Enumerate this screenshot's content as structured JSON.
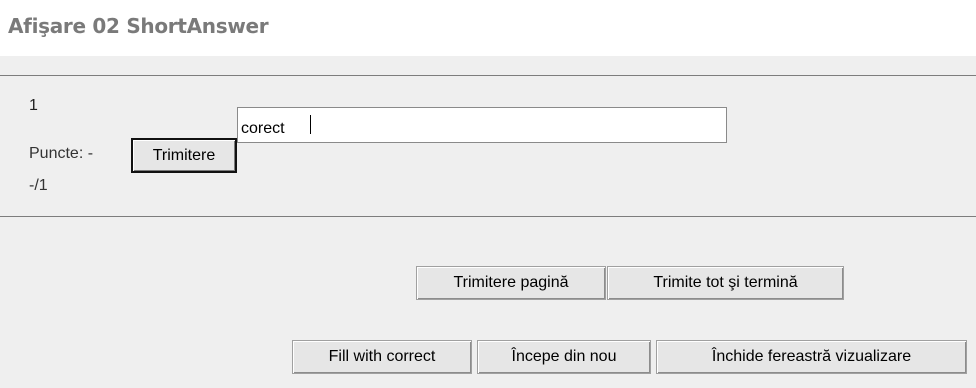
{
  "header": {
    "title": "Afişare 02 ShortAnswer"
  },
  "question": {
    "number": "1",
    "points_label": "Puncte: -",
    "points_value": "-/1",
    "submit_label": "Trimitere",
    "answer_value": "corect"
  },
  "actions": {
    "submit_page": "Trimitere pagină",
    "submit_all": "Trimite tot şi termină",
    "fill_correct": "Fill with correct",
    "restart": "Începe din nou",
    "close_preview": "Închide fereastră vizualizare"
  }
}
